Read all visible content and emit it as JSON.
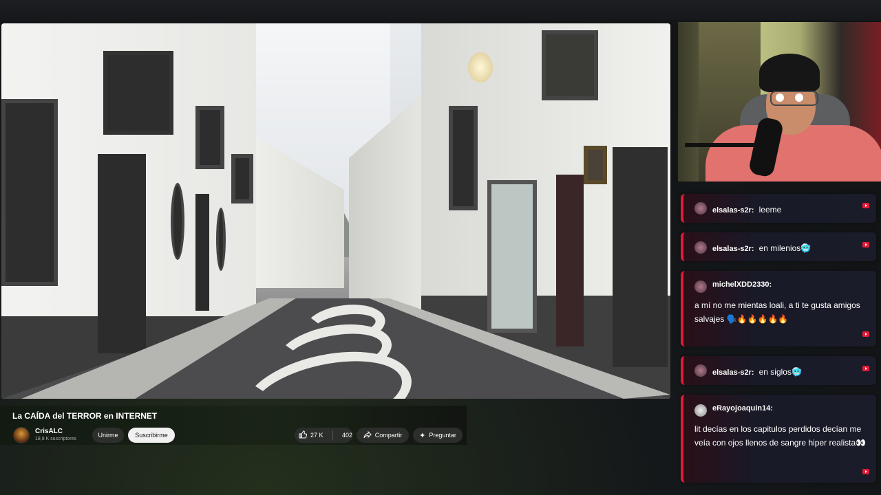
{
  "video": {
    "title": "La CAÍDA del TERROR en INTERNET",
    "channel": {
      "name": "CrisALC",
      "subscribers": "18,8 K suscriptores"
    },
    "buttons": {
      "join": "Unirme",
      "subscribe": "Suscribirme",
      "likes": "27 K",
      "comments_count": "402",
      "share": "Compartir",
      "ask": "Preguntar"
    },
    "icons": {
      "like": "thumbs-up-icon",
      "share": "share-arrow-icon",
      "ask": "sparkle-icon"
    }
  },
  "chat": {
    "messages": [
      {
        "user": "elsalas-s2r:",
        "text": "leeme"
      },
      {
        "user": "elsalas-s2r:",
        "text": "en milenios🥶"
      },
      {
        "user": "michelXDD2330:",
        "text": "a mí no me mientas loali, a ti te gusta amigos salvajes 🗣️🔥🔥🔥🔥🔥"
      },
      {
        "user": "elsalas-s2r:",
        "text": "en siglos🥶"
      },
      {
        "user": "eRayojoaquin14:",
        "text": "lit decías en los capitulos perdidos decían me veía con ojos llenos de sangre hiper realista👀"
      }
    ],
    "platform_icon": "youtube-icon",
    "accent": "#e31b37"
  },
  "webcam": {
    "label": "streamer-webcam"
  }
}
